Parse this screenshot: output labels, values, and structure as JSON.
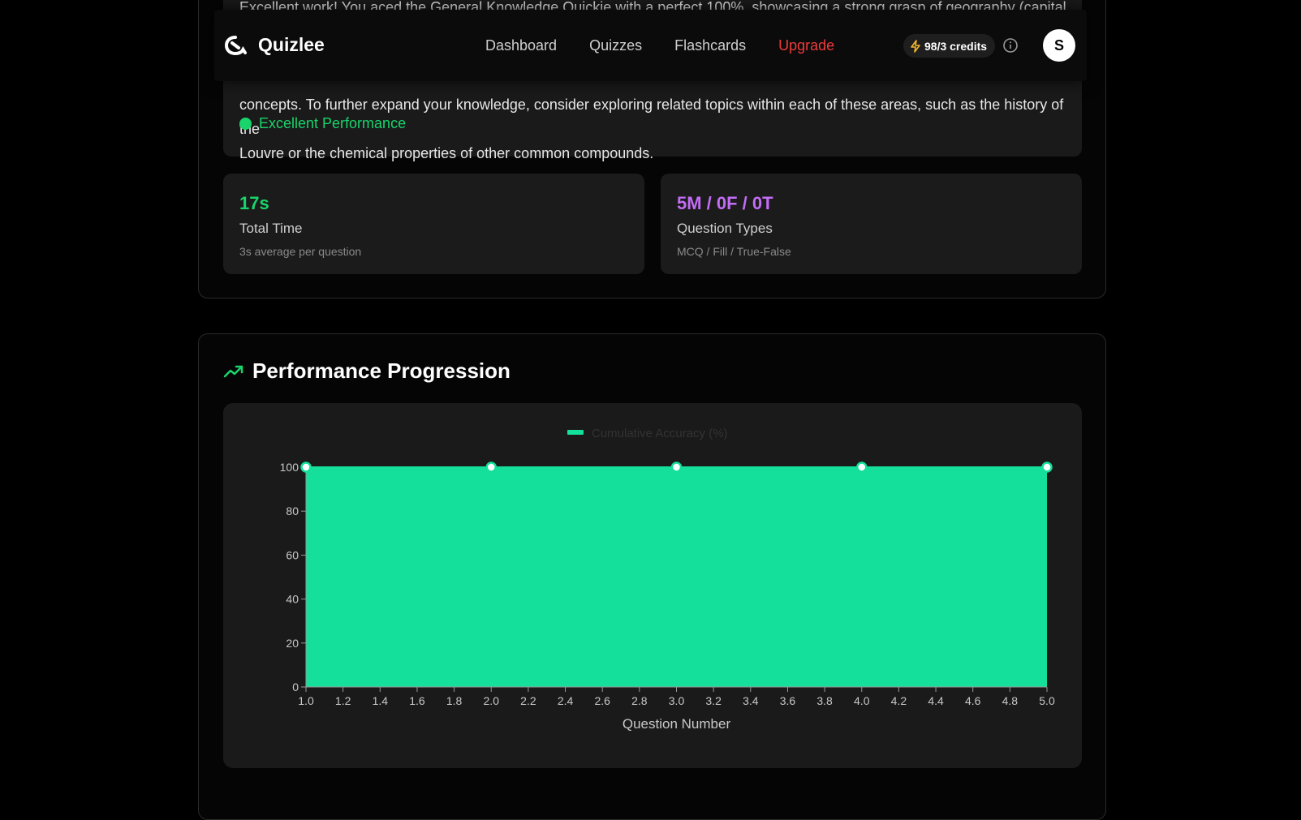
{
  "summary": {
    "feedback_lines": [
      "Excellent work! You aced the General Knowledge Quickie with a perfect 100%, showcasing a strong grasp of geography (capital of",
      "concepts. To further expand your knowledge, consider exploring related topics within each of these areas, such as the history of the",
      "Louvre or the chemical properties of other common compounds."
    ],
    "performance_label": "Excellent Performance",
    "performance_color": "#19d46b"
  },
  "stats": [
    {
      "value": "17s",
      "title": "Total Time",
      "subtitle": "3s average per question",
      "color": "#19d46b"
    },
    {
      "value": "5M / 0F / 0T",
      "title": "Question Types",
      "subtitle": "MCQ / Fill / True-False",
      "color": "#c36cf5"
    }
  ],
  "nav": {
    "brand": "Quizlee",
    "links": [
      "Dashboard",
      "Quizzes",
      "Flashcards"
    ],
    "upgrade": "Upgrade",
    "credits": "98/3 credits",
    "avatar_initial": "S"
  },
  "section": {
    "title": "Performance Progression",
    "icon": "trending-up-icon"
  },
  "chart_data": {
    "type": "area",
    "x": [
      1,
      2,
      3,
      4,
      5
    ],
    "series": [
      {
        "name": "Cumulative Accuracy (%)",
        "values": [
          100,
          100,
          100,
          100,
          100
        ]
      }
    ],
    "xlabel": "Question Number",
    "ylabel": "",
    "xlim": [
      1.0,
      5.0
    ],
    "ylim": [
      0,
      100
    ],
    "xticks": [
      "1.0",
      "1.2",
      "1.4",
      "1.6",
      "1.8",
      "2.0",
      "2.2",
      "2.4",
      "2.6",
      "2.8",
      "3.0",
      "3.2",
      "3.4",
      "3.6",
      "3.8",
      "4.0",
      "4.2",
      "4.4",
      "4.6",
      "4.8",
      "5.0"
    ],
    "yticks": [
      "0",
      "20",
      "40",
      "60",
      "80",
      "100"
    ],
    "fill_color": "#14df9b",
    "legend_position": "top",
    "grid": false
  }
}
